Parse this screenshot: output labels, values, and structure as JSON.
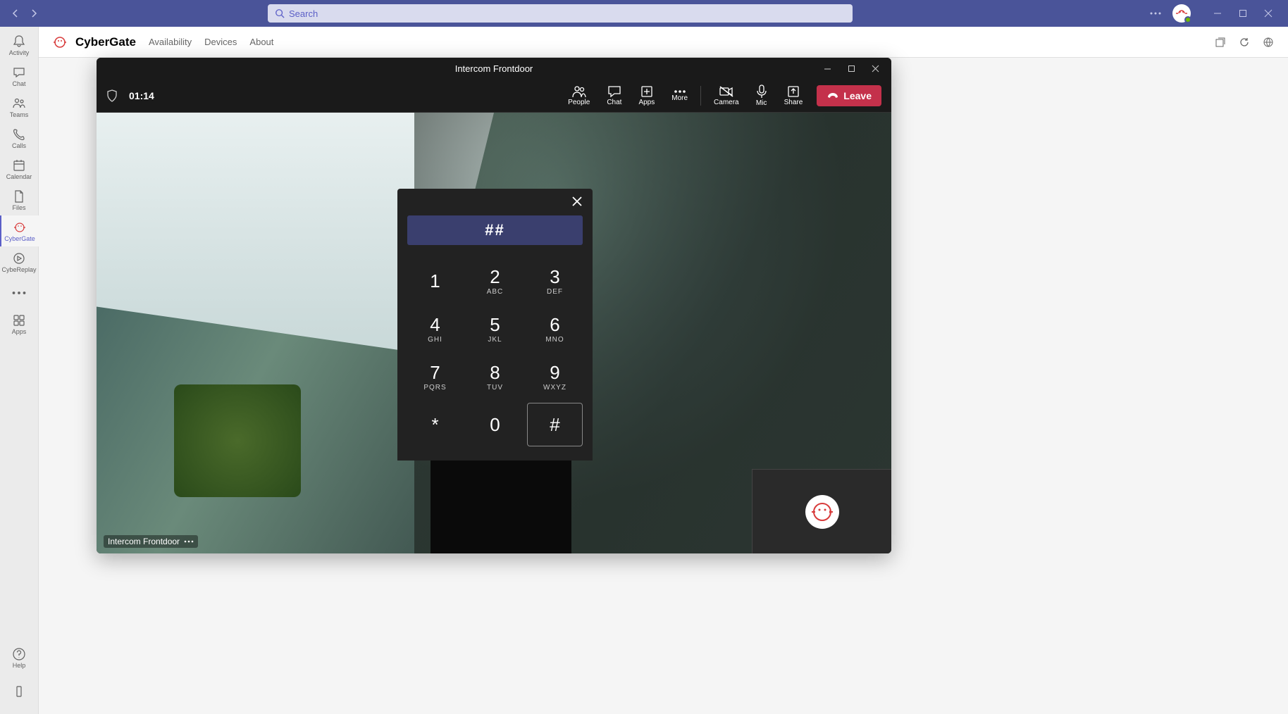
{
  "titlebar": {
    "search_placeholder": "Search"
  },
  "rail": {
    "activity": "Activity",
    "chat": "Chat",
    "teams": "Teams",
    "calls": "Calls",
    "calendar": "Calendar",
    "files": "Files",
    "cybergate": "CyberGate",
    "cybereplay": "CybeReplay",
    "apps": "Apps",
    "help": "Help"
  },
  "app_header": {
    "title": "CyberGate",
    "tabs": [
      "Availability",
      "Devices",
      "About"
    ]
  },
  "call": {
    "title": "Intercom Frontdoor",
    "timer": "01:14",
    "toolbar": {
      "people": "People",
      "chat": "Chat",
      "apps": "Apps",
      "more": "More",
      "camera": "Camera",
      "mic": "Mic",
      "share": "Share",
      "leave": "Leave"
    },
    "participant_label": "Intercom Frontdoor"
  },
  "dialpad": {
    "display": "##",
    "keys": [
      {
        "digit": "1",
        "letters": ""
      },
      {
        "digit": "2",
        "letters": "ABC"
      },
      {
        "digit": "3",
        "letters": "DEF"
      },
      {
        "digit": "4",
        "letters": "GHI"
      },
      {
        "digit": "5",
        "letters": "JKL"
      },
      {
        "digit": "6",
        "letters": "MNO"
      },
      {
        "digit": "7",
        "letters": "PQRS"
      },
      {
        "digit": "8",
        "letters": "TUV"
      },
      {
        "digit": "9",
        "letters": "WXYZ"
      },
      {
        "digit": "*",
        "letters": ""
      },
      {
        "digit": "0",
        "letters": ""
      },
      {
        "digit": "#",
        "letters": "",
        "highlighted": true
      }
    ]
  }
}
